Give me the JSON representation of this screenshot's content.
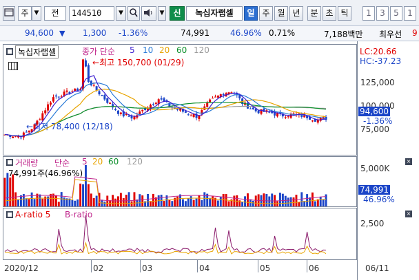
{
  "toolbar": {
    "period": "주",
    "mode": "전",
    "code": "144510",
    "shin": "신",
    "stock_name": "녹십자랩셀",
    "tabs": [
      "일",
      "주",
      "월",
      "년",
      "분",
      "초",
      "틱"
    ],
    "active_tab": "일",
    "nums": [
      "1",
      "3",
      "5",
      "1"
    ]
  },
  "info": {
    "price": "94,600",
    "arrow": "▼",
    "change": "1,300",
    "change_pct": "-1.36%",
    "volume": "74,991",
    "vol_ratio": "46.96%",
    "turnover": "0.71%",
    "amount": "7,188백만",
    "rank": "최우선",
    "rank_val": "9"
  },
  "price_pane": {
    "title": "녹십자랩셀",
    "legend_label": "종가 단순",
    "ma": [
      "5",
      "10",
      "20",
      "60",
      "120"
    ],
    "lc": "LC:20.66",
    "hc": "HC:-37.23",
    "high_label": "최고 150,700 (01/29)",
    "low_label": "최저 78,400 (12/18)",
    "ticks": [
      "125,000",
      "100,000",
      "75,000"
    ],
    "last_price": "94,600",
    "last_pct": "-1.36%"
  },
  "volume_pane": {
    "title": "거래량",
    "legend_label": "단순",
    "ma": [
      "5",
      "20",
      "60",
      "120"
    ],
    "vol_label": "74,991주(46.96%)",
    "ticks": [
      "5,000K"
    ],
    "last_vol": "74,991",
    "last_pct": "46.96%"
  },
  "ab_pane": {
    "a_label": "A-ratio 5",
    "b_label": "B-ratio",
    "ticks": [
      "2,500"
    ]
  },
  "xaxis": {
    "labels": [
      "2020/12",
      "02",
      "03",
      "04",
      "05",
      "06",
      "06/11"
    ]
  },
  "colors": {
    "up": "#e00000",
    "down": "#1b45c8",
    "ma5": "#3b1cd0",
    "ma10": "#2a7bd8",
    "ma20": "#e8a400",
    "ma60": "#0b8f2a",
    "ma120": "#9a9a9a"
  }
}
